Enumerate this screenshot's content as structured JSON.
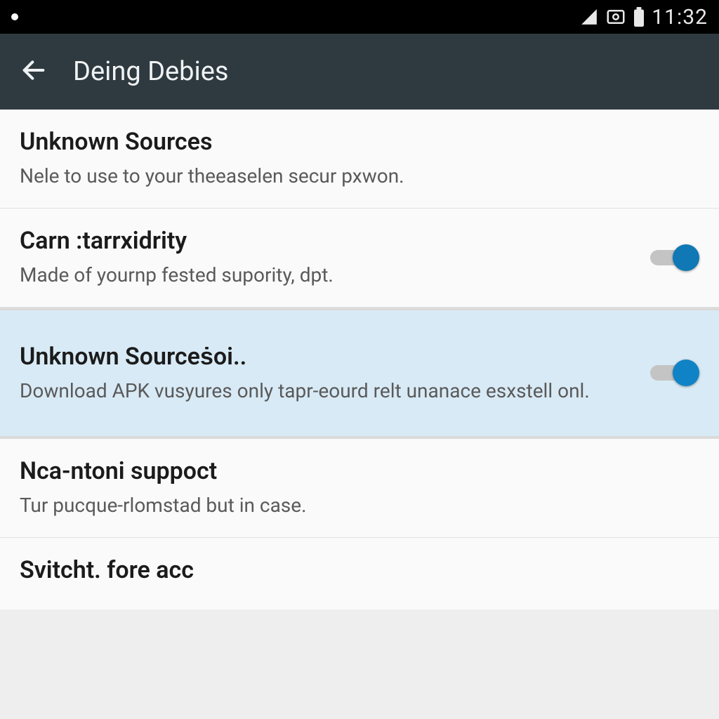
{
  "status_bar": {
    "time": "11:32"
  },
  "app_bar": {
    "title": "Deing Debies"
  },
  "settings": [
    {
      "title": "Unknown Sources",
      "subtitle": "Nele to use to your theeaselen secur pxwon.",
      "has_toggle": false,
      "toggle_on": false,
      "highlighted": false
    },
    {
      "title": "Carn :tarrxidrity",
      "subtitle": "Made of yournp fested supority, dpt.",
      "has_toggle": true,
      "toggle_on": true,
      "highlighted": false
    },
    {
      "title": "Unknown Sourceṡoi..",
      "subtitle": "Download APK vusyures only tapr-eourd relt unanace esxstell onl.",
      "has_toggle": true,
      "toggle_on": true,
      "highlighted": true
    },
    {
      "title": "Nca-ntoni suppoct",
      "subtitle": "Tur pucque-rlomstad but in case.",
      "has_toggle": false,
      "toggle_on": false,
      "highlighted": false
    },
    {
      "title": "Svitcht. fore acc",
      "subtitle": "",
      "has_toggle": false,
      "toggle_on": false,
      "highlighted": false
    }
  ]
}
